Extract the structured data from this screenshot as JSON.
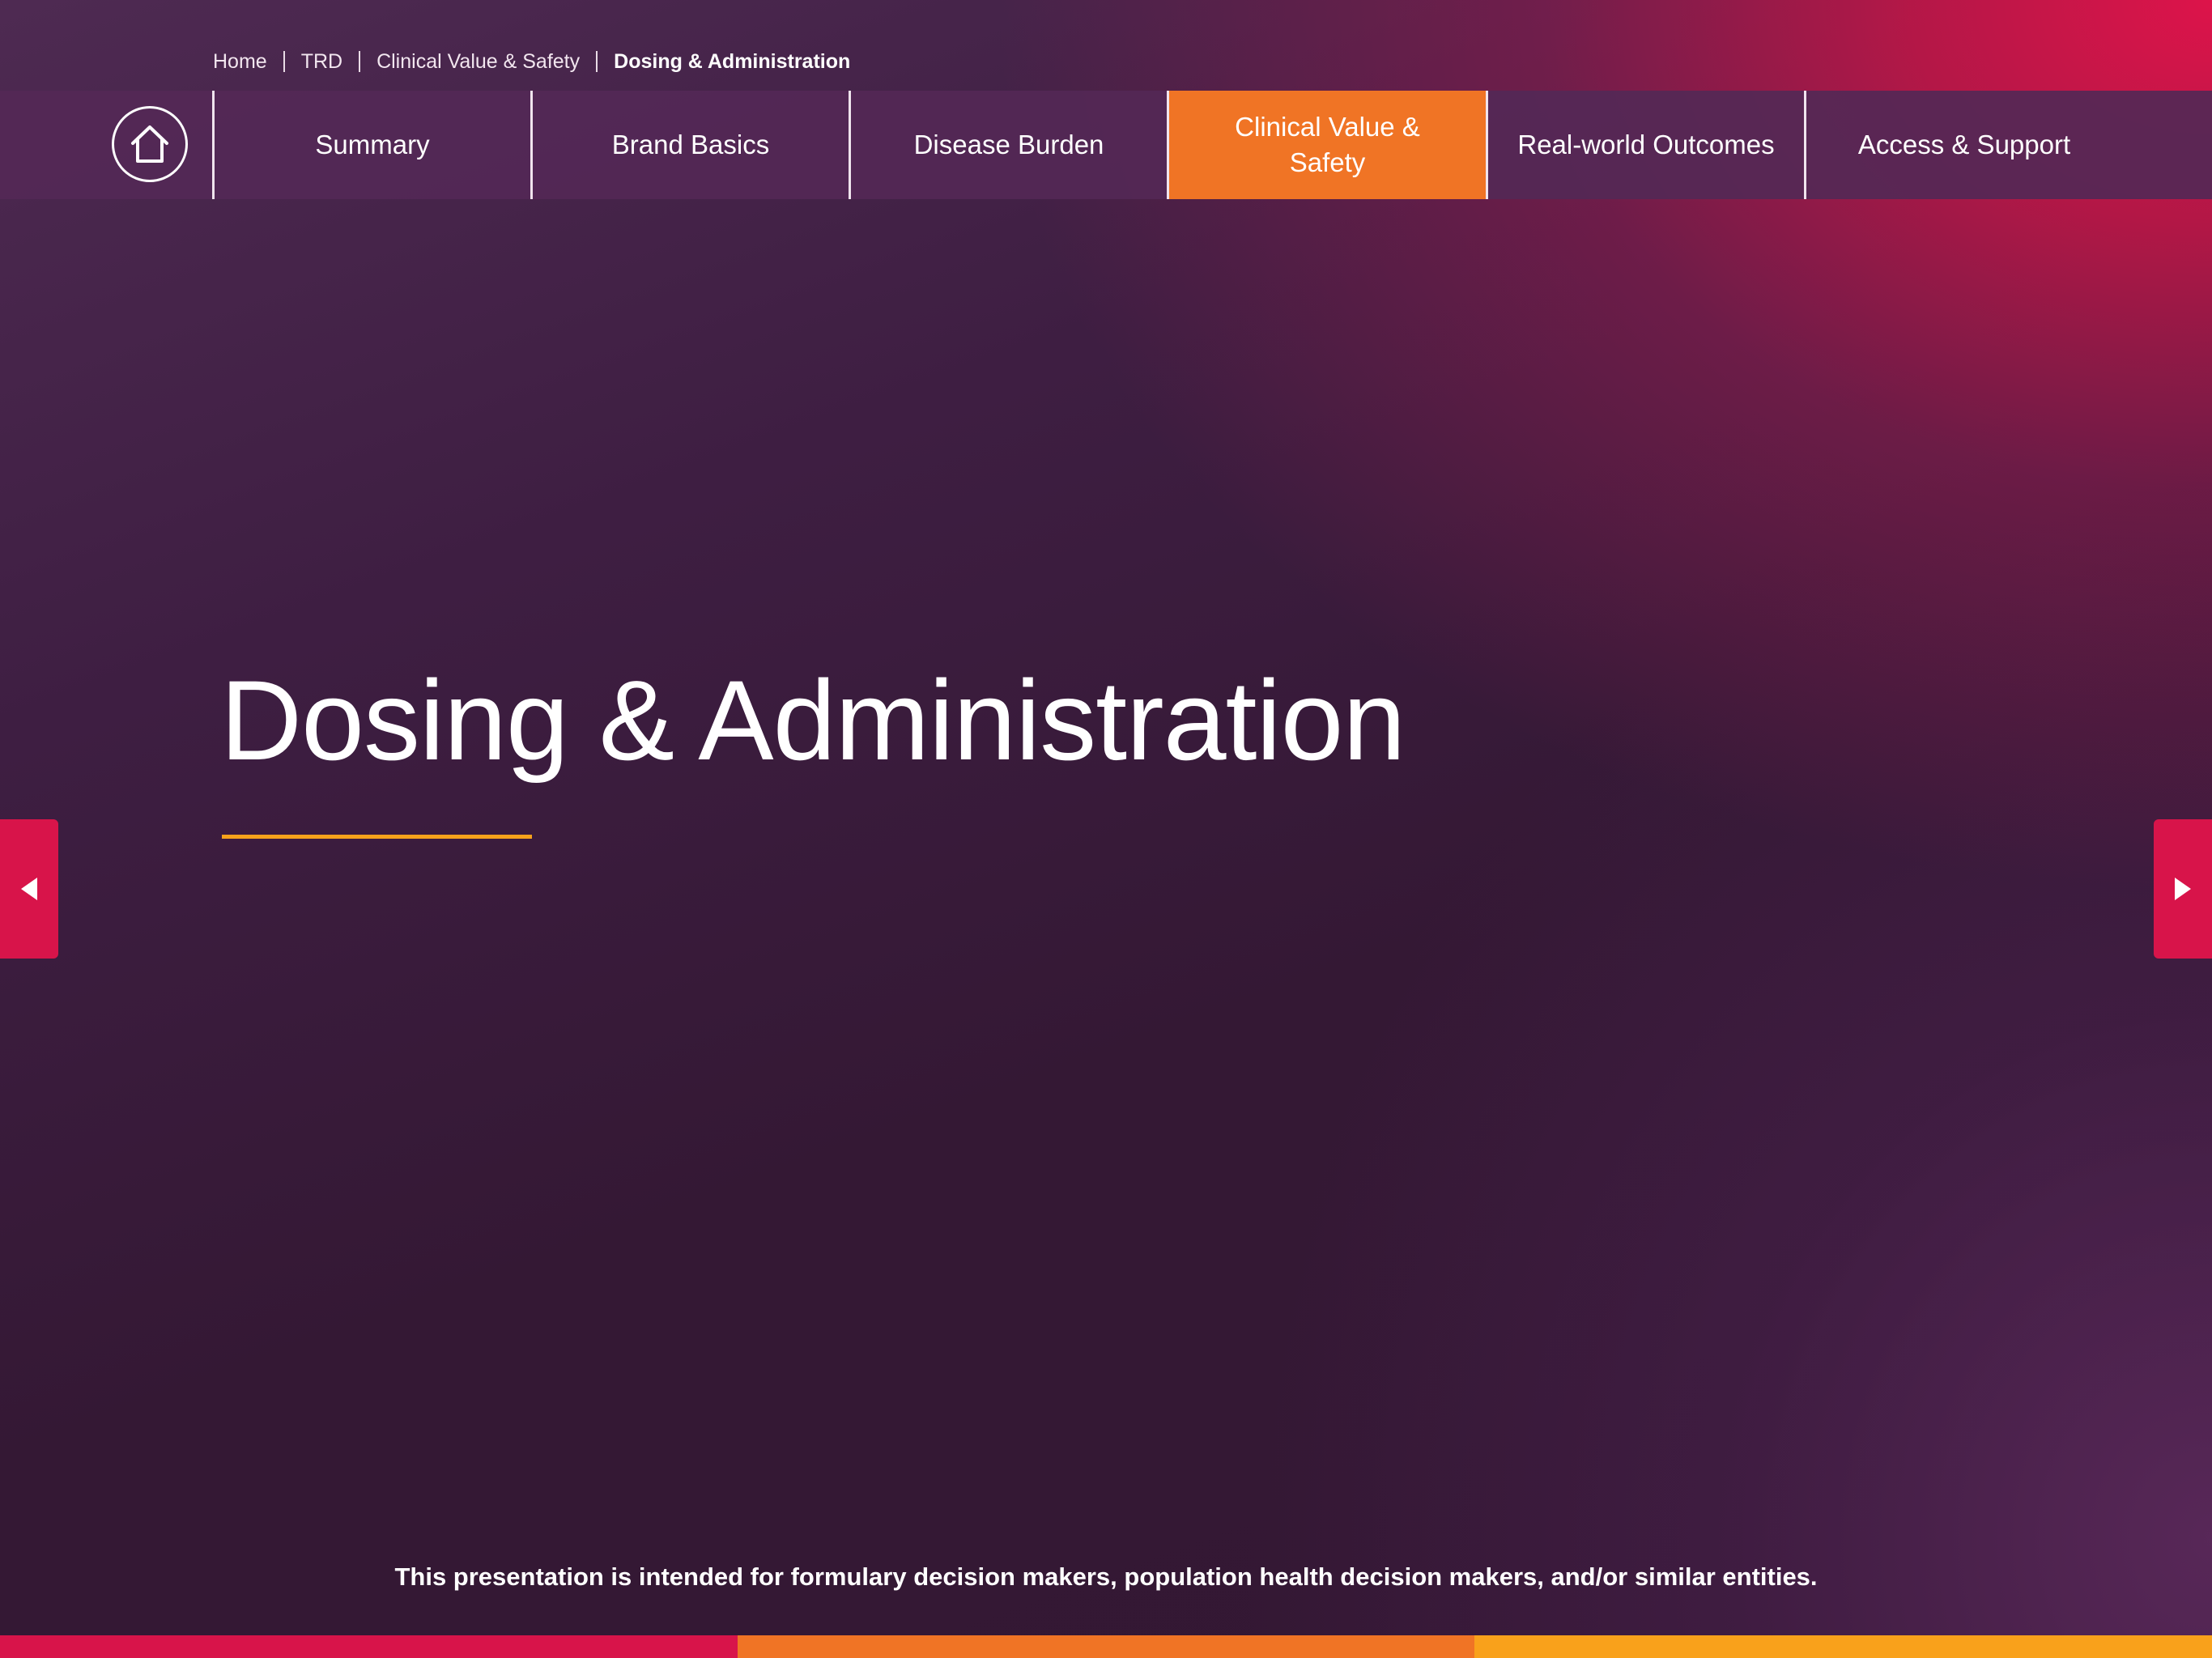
{
  "breadcrumb": {
    "items": [
      "Home",
      "TRD",
      "Clinical Value & Safety",
      "Dosing & Administration"
    ]
  },
  "nav": {
    "home_icon": "home-icon",
    "tabs": [
      {
        "label": "Summary",
        "active": false
      },
      {
        "label": "Brand Basics",
        "active": false
      },
      {
        "label": "Disease Burden",
        "active": false
      },
      {
        "label": "Clinical Value & Safety",
        "active": true
      },
      {
        "label": "Real-world Outcomes",
        "active": false
      },
      {
        "label": "Access & Support",
        "active": false
      }
    ]
  },
  "main": {
    "title": "Dosing & Administration"
  },
  "arrows": {
    "prev_icon": "caret-left-icon",
    "next_icon": "caret-right-icon"
  },
  "footer": {
    "disclaimer": "This presentation is intended for formulary decision makers, population health decision makers, and/or similar entities."
  },
  "colors": {
    "accent_orange": "#f07425",
    "accent_crimson": "#d8144a",
    "underline_gold": "#f6a21b",
    "nav_background": "#542856",
    "bottom_bar": [
      "#d8144a",
      "#f07425",
      "#f9a11b"
    ]
  }
}
